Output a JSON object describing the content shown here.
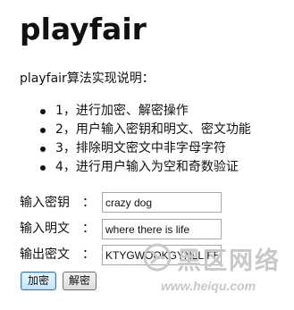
{
  "page": {
    "title": "playfair",
    "intro": "playfair算法实现说明："
  },
  "features": [
    "1，进行加密、解密操作",
    "2，用户输入密钥和明文、密文功能",
    "3，排除明文密文中非字母字符",
    "4，进行用户输入为空和奇数验证"
  ],
  "form": {
    "key": {
      "label": "输入密钥",
      "colon": "：",
      "value": "crazy dog"
    },
    "plaintext": {
      "label": "输入明文",
      "colon": "：",
      "value": "where there is life"
    },
    "ciphertext": {
      "label": "输出密文",
      "colon": "：",
      "value": "KTYGWOOKGYNLLIFE"
    }
  },
  "buttons": {
    "encrypt": "加密",
    "decrypt": "解密"
  },
  "watermark": {
    "text": "黑区网络",
    "url": "www.heiqu.com",
    "logo": "heiqu-logo-icon",
    "color": "#c8c8c8"
  }
}
